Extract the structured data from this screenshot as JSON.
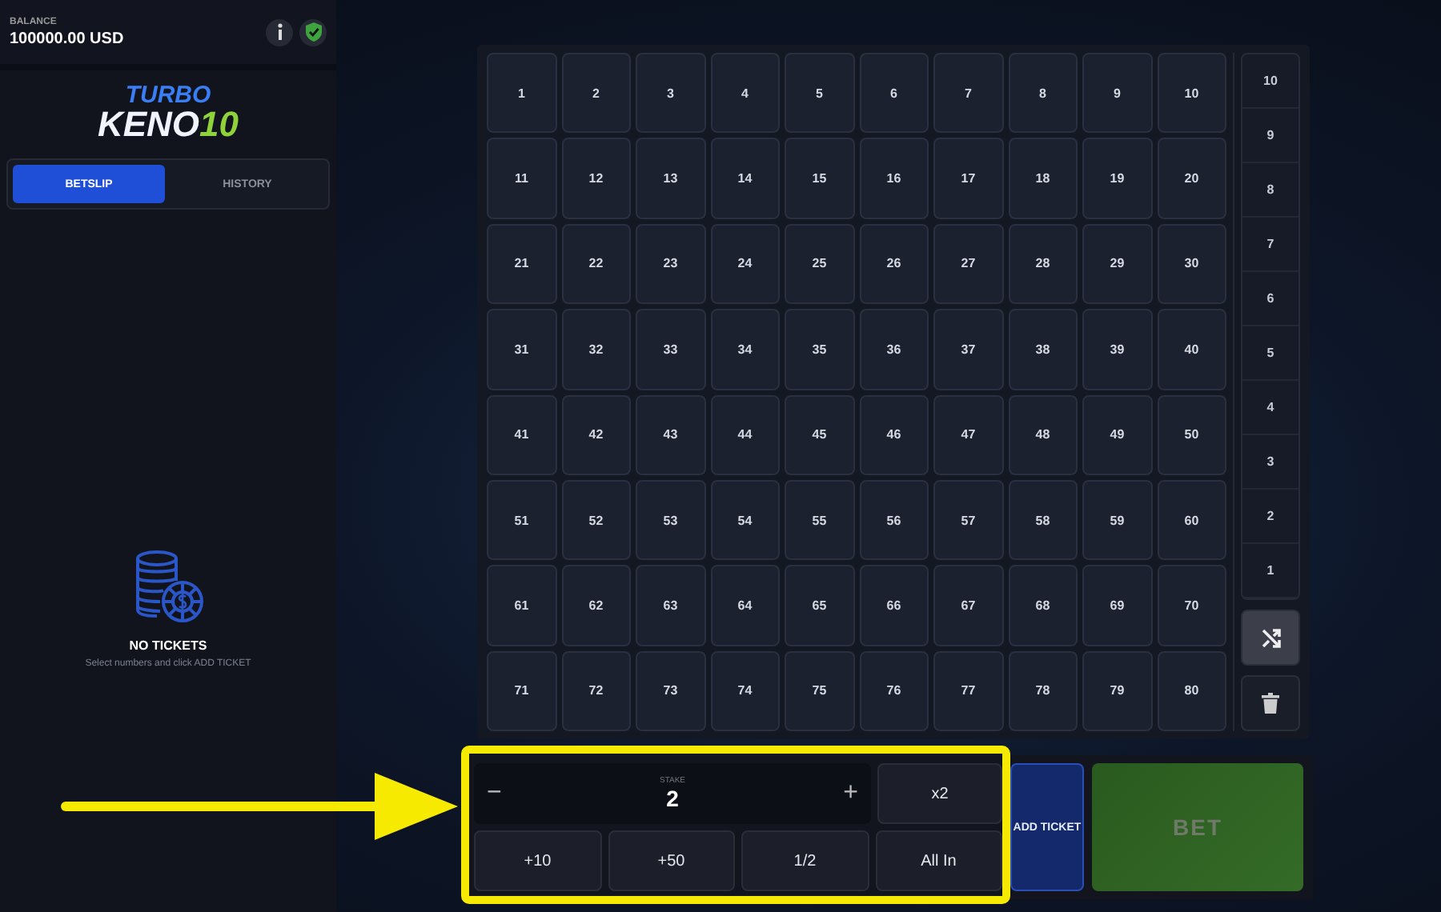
{
  "balance": {
    "label": "BALANCE",
    "amount": "100000.00 USD"
  },
  "logo": {
    "line1": "TURBO",
    "line2": "KENO",
    "line3": "10"
  },
  "tabs": [
    {
      "label": "BETSLIP",
      "selected": true
    },
    {
      "label": "HISTORY",
      "selected": false
    }
  ],
  "empty_state": {
    "title": "NO TICKETS",
    "hint": "Select numbers and click ADD TICKET"
  },
  "numbers": [
    "1",
    "2",
    "3",
    "4",
    "5",
    "6",
    "7",
    "8",
    "9",
    "10",
    "11",
    "12",
    "13",
    "14",
    "15",
    "16",
    "17",
    "18",
    "19",
    "20",
    "21",
    "22",
    "23",
    "24",
    "25",
    "26",
    "27",
    "28",
    "29",
    "30",
    "31",
    "32",
    "33",
    "34",
    "35",
    "36",
    "37",
    "38",
    "39",
    "40",
    "41",
    "42",
    "43",
    "44",
    "45",
    "46",
    "47",
    "48",
    "49",
    "50",
    "51",
    "52",
    "53",
    "54",
    "55",
    "56",
    "57",
    "58",
    "59",
    "60",
    "61",
    "62",
    "63",
    "64",
    "65",
    "66",
    "67",
    "68",
    "69",
    "70",
    "71",
    "72",
    "73",
    "74",
    "75",
    "76",
    "77",
    "78",
    "79",
    "80"
  ],
  "pick_counts": [
    "10",
    "9",
    "8",
    "7",
    "6",
    "5",
    "4",
    "3",
    "2",
    "1"
  ],
  "stake": {
    "label": "STAKE",
    "value": "2",
    "minus": "−",
    "plus": "+"
  },
  "quick_buttons": [
    "x2",
    "+10",
    "+50",
    "1/2",
    "All In"
  ],
  "add_ticket": "ADD TICKET",
  "bet": {
    "label": "BET",
    "disabled": true
  }
}
